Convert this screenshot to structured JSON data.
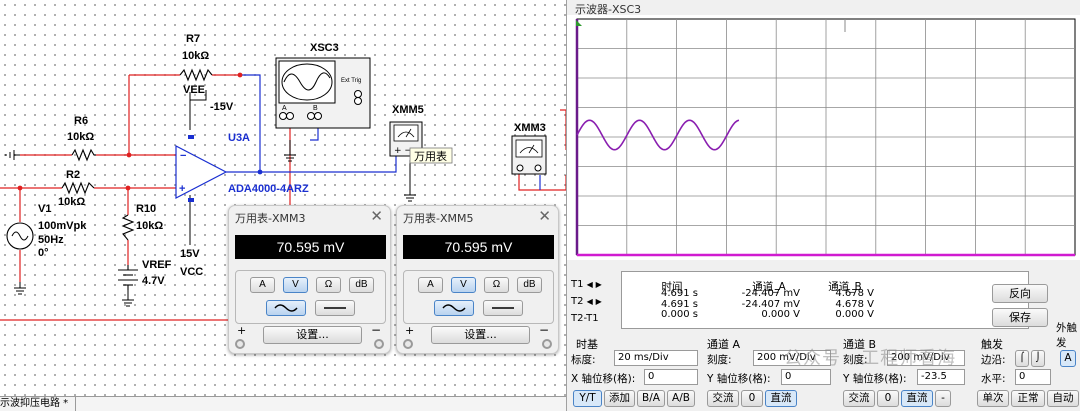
{
  "schematic": {
    "r7": {
      "name": "R7",
      "value": "10kΩ"
    },
    "r6": {
      "name": "R6",
      "value": "10kΩ"
    },
    "r2": {
      "name": "R2",
      "value": "10kΩ"
    },
    "r10": {
      "name": "R10",
      "value": "10kΩ"
    },
    "v1": {
      "name": "V1",
      "amp": "100mVpk",
      "freq": "50Hz",
      "phase": "0°"
    },
    "vref": {
      "name": "VREF",
      "value": "4.7V"
    },
    "vee": "VEE",
    "vee_val": "-15V",
    "vcc": "VCC",
    "vcc_val": "15V",
    "opamp_ref": "U3A",
    "opamp_part": "ADA4000-4ARZ",
    "xsc_name": "XSC3",
    "xsc_ext": "Ext Trig",
    "xsc_a": "A",
    "xsc_b": "B",
    "xmm5_name": "XMM5",
    "xmm3_name": "XMM3",
    "tooltip": "万用表"
  },
  "multimeters": [
    {
      "title": "万用表-XMM3",
      "reading": "70.595 mV",
      "set_label": "设置...",
      "buttons": [
        "A",
        "V",
        "Ω",
        "dB"
      ]
    },
    {
      "title": "万用表-XMM5",
      "reading": "70.595 mV",
      "set_label": "设置...",
      "buttons": [
        "A",
        "V",
        "Ω",
        "dB"
      ]
    }
  ],
  "scope": {
    "title": "示波器-XSC3",
    "readout_labels": [
      "T1",
      "T2",
      "T2-T1"
    ],
    "headers": [
      "时间",
      "通道_A",
      "通道_B"
    ],
    "time": [
      "4.691 s",
      "4.691 s",
      "0.000 s"
    ],
    "cha": [
      "-24.407 mV",
      "-24.407 mV",
      "0.000 V"
    ],
    "chb": [
      "4.678 V",
      "4.678 V",
      "0.000 V"
    ],
    "reverse": "反向",
    "save": "保存",
    "ext_trigger": "外触发",
    "timebase": {
      "title": "时基",
      "scale_label": "标度:",
      "scale": "20 ms/Div",
      "xpos_label": "X 轴位移(格):",
      "xpos": "0",
      "buttons": [
        "Y/T",
        "添加",
        "B/A",
        "A/B"
      ]
    },
    "cha_panel": {
      "title": "通道 A",
      "scale_label": "刻度:",
      "scale": "200 mV/Div",
      "ypos_label": "Y 轴位移(格):",
      "ypos": "0",
      "buttons": [
        "交流",
        "0",
        "直流"
      ]
    },
    "chb_panel": {
      "title": "通道 B",
      "scale_label": "刻度:",
      "scale": "200 mV/Div",
      "ypos_label": "Y 轴位移(格):",
      "ypos": "-23.5",
      "buttons": [
        "交流",
        "0",
        "直流",
        "-"
      ]
    },
    "trigger_panel": {
      "title": "触发",
      "edge_label": "边沿:",
      "level_label": "水平:",
      "level": "0",
      "edge_a": "A",
      "buttons": [
        "单次",
        "正常",
        "自动"
      ]
    },
    "trace_color": "#8a1fb0"
  },
  "tab": {
    "label": "示波抑压电路 *"
  },
  "watermark": "公众号 · 工程师看海"
}
